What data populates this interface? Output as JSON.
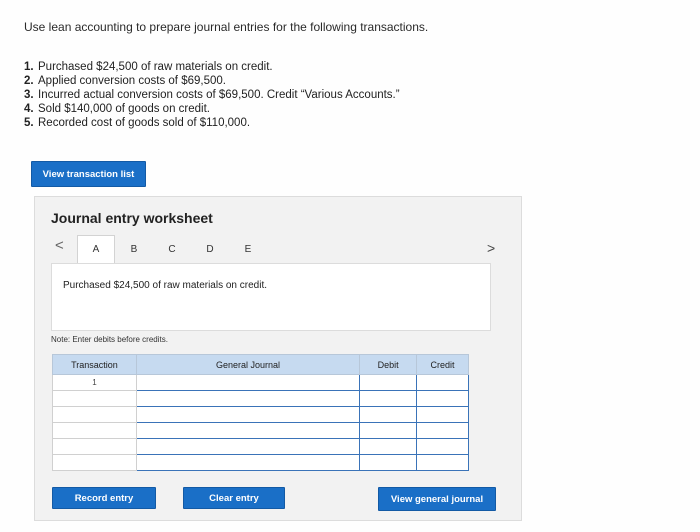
{
  "instructions": "Use lean accounting to prepare journal entries for the following transactions.",
  "transactions": [
    {
      "num": "1.",
      "text": "Purchased $24,500 of raw materials on credit."
    },
    {
      "num": "2.",
      "text": "Applied conversion costs of $69,500."
    },
    {
      "num": "3.",
      "text": "Incurred actual conversion costs of $69,500. Credit “Various Accounts.”"
    },
    {
      "num": "4.",
      "text": "Sold $140,000 of goods on credit."
    },
    {
      "num": "5.",
      "text": "Recorded cost of goods sold of $110,000."
    }
  ],
  "view_transaction_list_label": "View transaction list",
  "worksheet": {
    "title": "Journal entry worksheet",
    "prev_icon": "<",
    "next_icon": ">",
    "tabs": [
      "A",
      "B",
      "C",
      "D",
      "E"
    ],
    "active_tab": "A",
    "description": "Purchased $24,500 of raw materials on credit.",
    "note": "Note: Enter debits before credits.",
    "table": {
      "headers": {
        "transaction": "Transaction",
        "general_journal": "General Journal",
        "debit": "Debit",
        "credit": "Credit"
      },
      "rows": [
        {
          "transaction": "1"
        },
        {
          "transaction": ""
        },
        {
          "transaction": ""
        },
        {
          "transaction": ""
        },
        {
          "transaction": ""
        },
        {
          "transaction": ""
        }
      ]
    },
    "record_entry_label": "Record entry",
    "clear_entry_label": "Clear entry",
    "view_general_journal_label": "View general journal"
  },
  "colors": {
    "button_blue": "#1a6fc7",
    "header_blue": "#c6daf0",
    "input_border": "#3a73b8"
  }
}
